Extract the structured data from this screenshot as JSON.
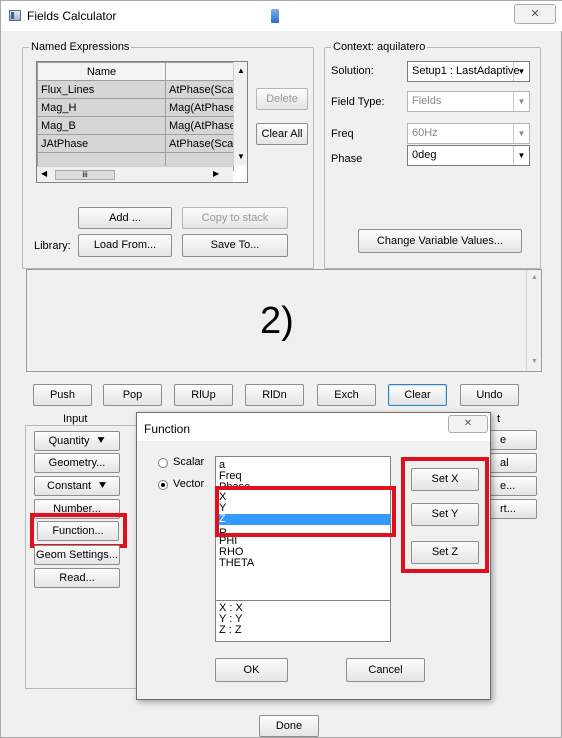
{
  "window": {
    "title": "Fields Calculator",
    "close_glyph": "✕"
  },
  "named_expressions": {
    "legend": "Named Expressions",
    "columns": [
      "Name",
      ""
    ],
    "rows": [
      {
        "name": "Flux_Lines",
        "expr": "AtPhase(Scal"
      },
      {
        "name": "Mag_H",
        "expr": "Mag(AtPhase"
      },
      {
        "name": "Mag_B",
        "expr": "Mag(AtPhase"
      },
      {
        "name": "JAtPhase",
        "expr": "AtPhase(Scal"
      }
    ],
    "delete_label": "Delete",
    "clear_all_label": "Clear All",
    "add_label": "Add ...",
    "copy_to_stack_label": "Copy to stack",
    "library_label": "Library:",
    "load_from_label": "Load From...",
    "save_to_label": "Save To..."
  },
  "context": {
    "legend": "Context: aquilatero",
    "solution_label": "Solution:",
    "solution_value": "Setup1 : LastAdaptive",
    "field_type_label": "Field Type:",
    "field_type_value": "Fields",
    "freq_label": "Freq",
    "freq_value": "60Hz",
    "phase_label": "Phase",
    "phase_value": "0deg",
    "change_vars_label": "Change Variable Values..."
  },
  "stack": {
    "annotation": "2)"
  },
  "stack_buttons": [
    "Push",
    "Pop",
    "RlUp",
    "RlDn",
    "Exch",
    "Clear",
    "Undo"
  ],
  "input": {
    "legend": "Input",
    "quantity_label": "Quantity",
    "geometry_label": "Geometry...",
    "constant_label": "Constant",
    "number_label": "Number...",
    "function_label": "Function...",
    "geom_settings_label": "Geom Settings...",
    "read_label": "Read..."
  },
  "background_partial": {
    "right_legend_tail": "t",
    "right_btn_fragments": [
      "e",
      "al",
      "e...",
      "rt..."
    ]
  },
  "function_dialog": {
    "title": "Function",
    "close_glyph": "✕",
    "scalar_label": "Scalar",
    "vector_label": "Vector",
    "selected_mode": "vector",
    "functions": [
      "a",
      "Freq",
      "Phase",
      "X",
      "Y",
      "Z",
      "R",
      "PHI",
      "RHO",
      "THETA"
    ],
    "selected_function": "Z",
    "set_x_label": "Set X",
    "set_y_label": "Set Y",
    "set_z_label": "Set Z",
    "assignments": [
      "X : X",
      "Y : Y",
      "Z : Z"
    ],
    "ok_label": "OK",
    "cancel_label": "Cancel"
  },
  "done_label": "Done",
  "colors": {
    "highlight_red": "#e0101d",
    "selection_blue": "#3399ff"
  }
}
